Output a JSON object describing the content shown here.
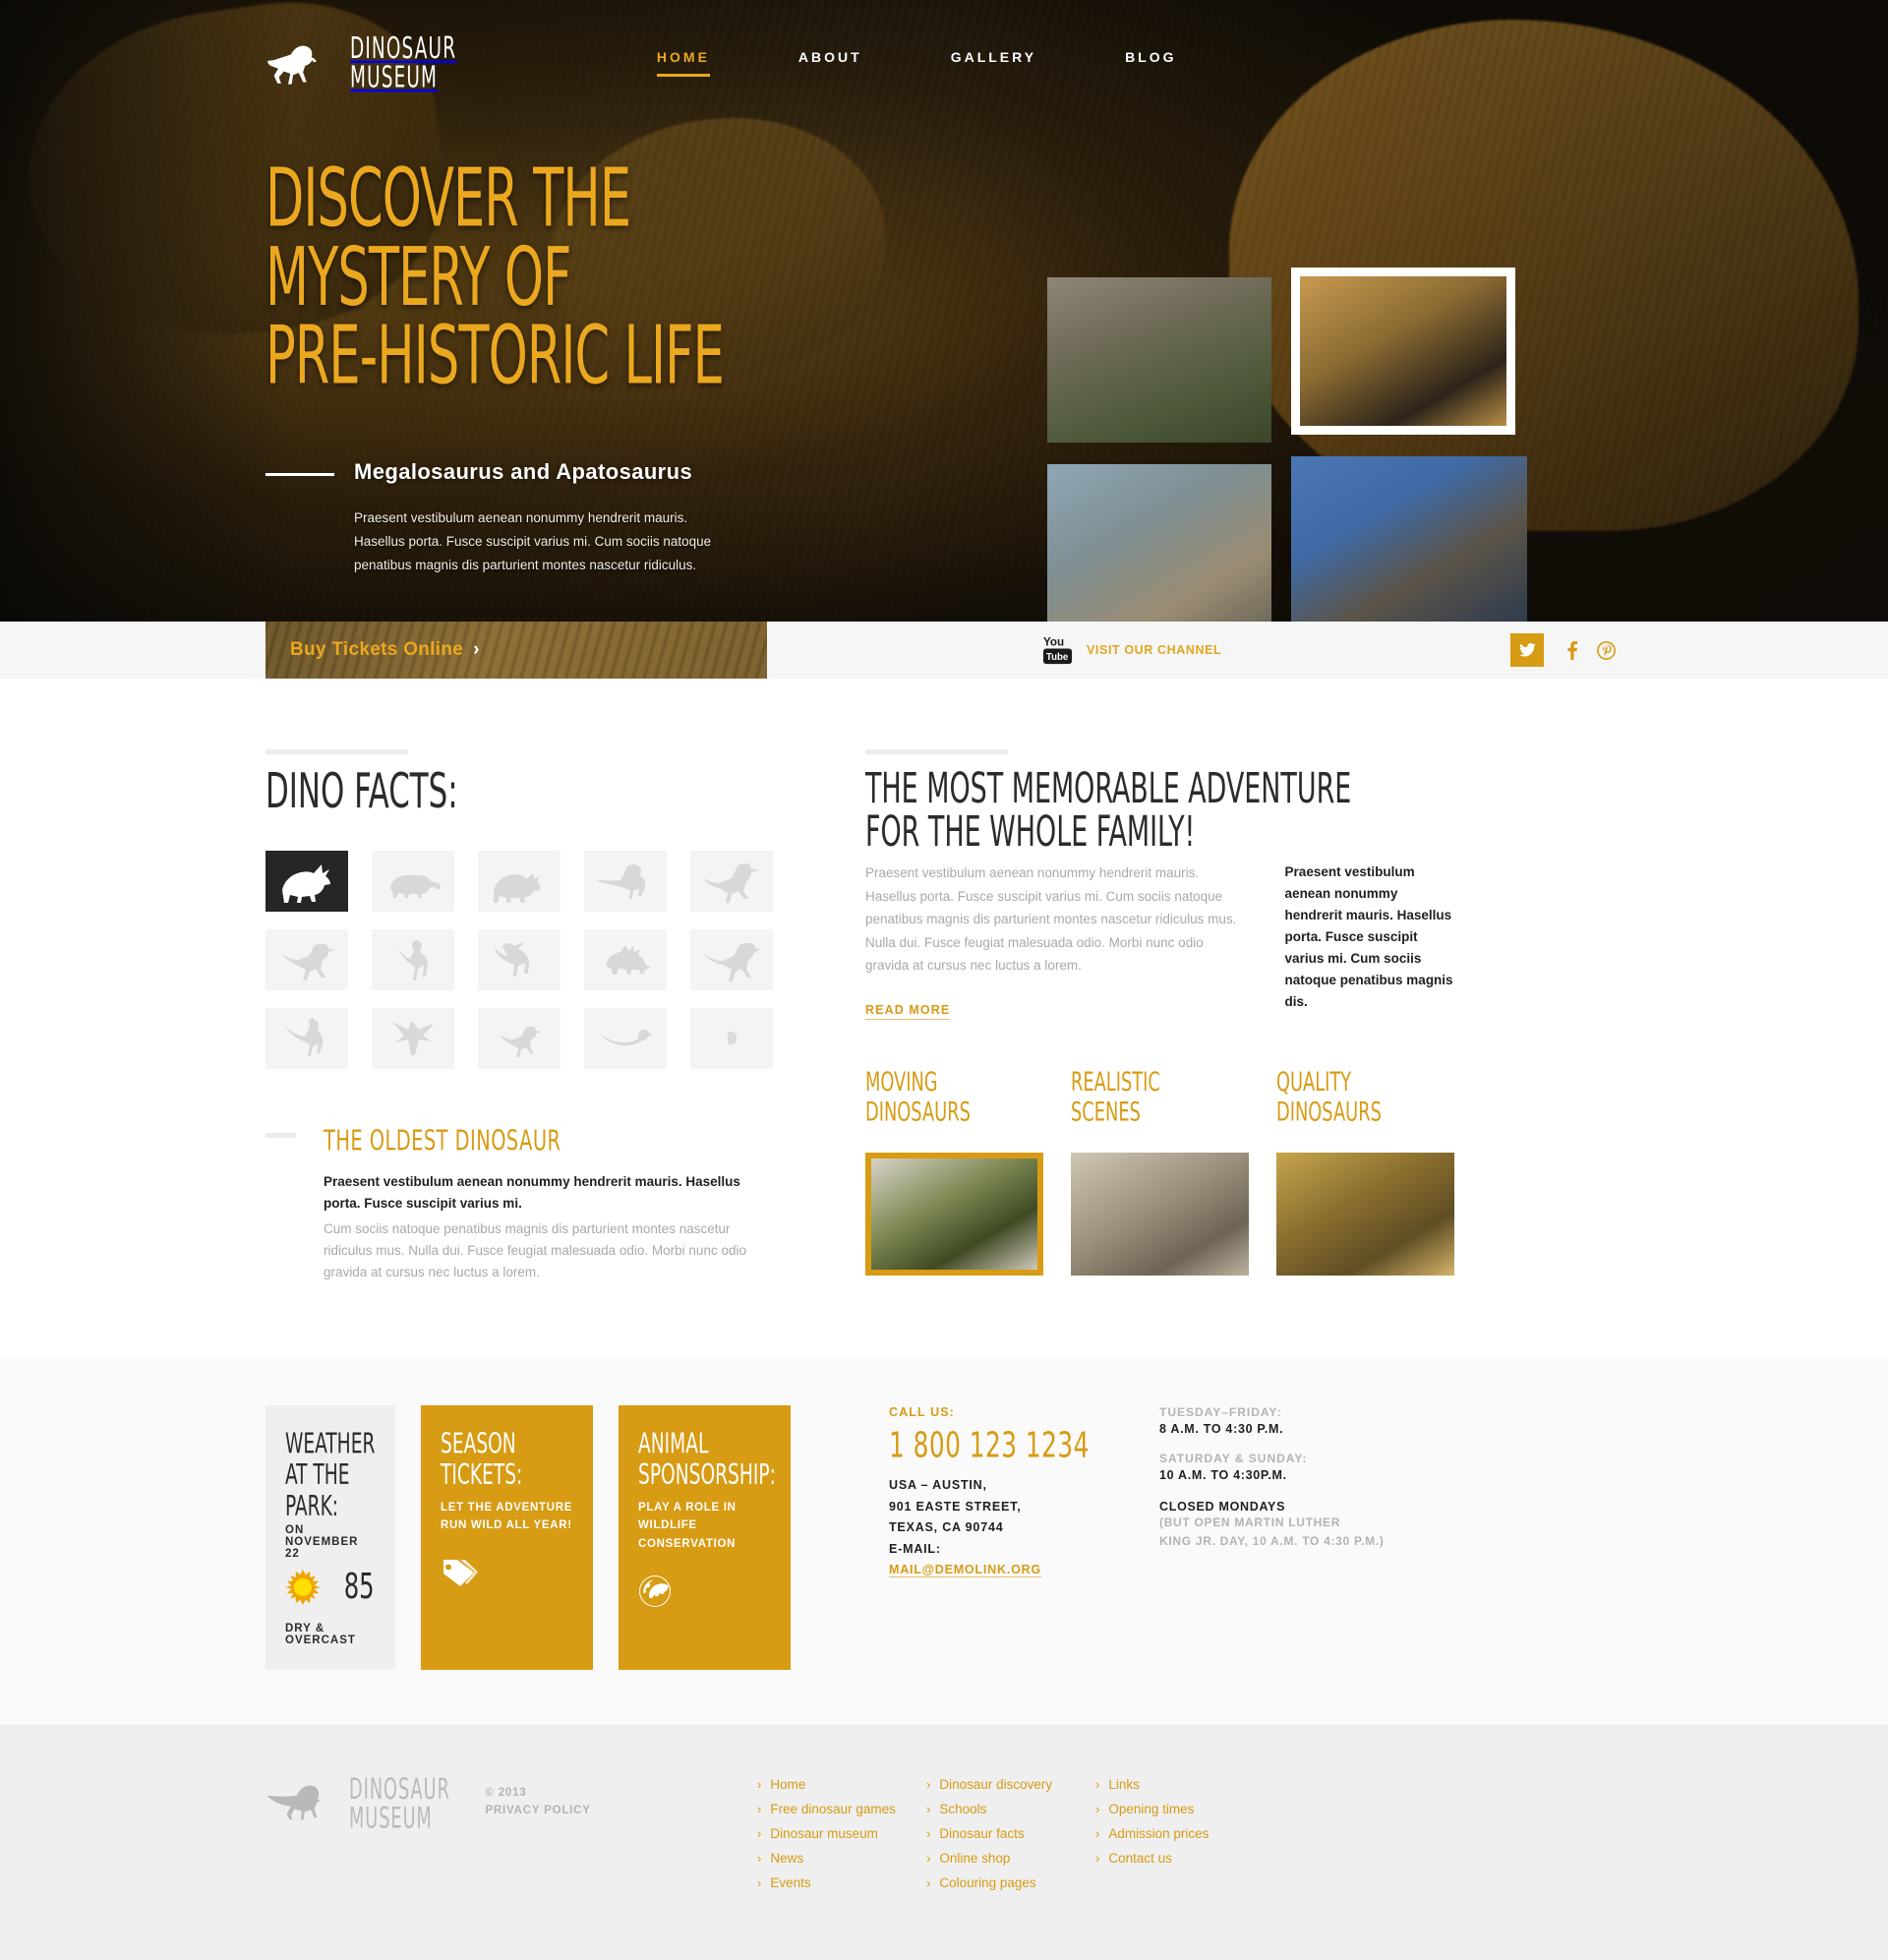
{
  "brand": {
    "line1": "Dinosaur",
    "line2": "Museum",
    "logo_icon": "dinosaur-silhouette-icon"
  },
  "nav": {
    "items": [
      {
        "label": "HOME",
        "active": true
      },
      {
        "label": "ABOUT",
        "active": false
      },
      {
        "label": "GALLERY",
        "active": false
      },
      {
        "label": "BLOG",
        "active": false
      }
    ]
  },
  "hero": {
    "title_line1": "DISCOVER THE",
    "title_line2": "MYSTERY OF",
    "title_line3": "PRE-HISTORIC LIFE",
    "subtitle": "Megalosaurus and Apatosaurus",
    "paragraph": "Praesent vestibulum aenean nonummy hendrerit mauris. Hasellus porta. Fusce suscipit varius mi. Cum sociis natoque penatibus magnis dis parturient montes nascetur ridiculus.",
    "gallery": [
      {
        "name": "thumb-allosaurus-head"
      },
      {
        "name": "thumb-museum-dinosaur-active"
      },
      {
        "name": "thumb-blue-dinosaur-head"
      },
      {
        "name": "thumb-roaring-dinosaur"
      }
    ]
  },
  "ticketbar": {
    "buy_label": "Buy Tickets Online",
    "buy_chevron": "›",
    "youtube_label": "VISIT OUR CHANNEL",
    "youtube_top": "You",
    "youtube_bottom": "Tube",
    "socials": [
      {
        "name": "twitter-icon",
        "boxed": true
      },
      {
        "name": "facebook-icon",
        "boxed": false
      },
      {
        "name": "pinterest-icon",
        "boxed": false
      }
    ]
  },
  "dinofacts": {
    "title": "DINO FACTS:",
    "icons": [
      {
        "name": "triceratops-icon",
        "active": true
      },
      {
        "name": "ankylosaurus-icon",
        "active": false
      },
      {
        "name": "triceratops-side-icon",
        "active": false
      },
      {
        "name": "brachiosaurus-icon",
        "active": false
      },
      {
        "name": "velociraptor-icon",
        "active": false
      },
      {
        "name": "raptor-running-icon",
        "active": false
      },
      {
        "name": "gallimimus-icon",
        "active": false
      },
      {
        "name": "parasaurolophus-icon",
        "active": false
      },
      {
        "name": "stegosaurus-icon",
        "active": false
      },
      {
        "name": "tyrannosaurus-icon",
        "active": false
      },
      {
        "name": "diplodocus-icon",
        "active": false
      },
      {
        "name": "pterodactyl-icon",
        "active": false
      },
      {
        "name": "compsognathus-icon",
        "active": false
      },
      {
        "name": "plesiosaur-icon",
        "active": false
      },
      {
        "name": "more-icon",
        "active": false
      }
    ],
    "oldest_heading": "THE OLDEST DINOSAUR",
    "oldest_lead": "Praesent vestibulum aenean nonummy hendrerit mauris. Hasellus porta. Fusce suscipit varius mi.",
    "oldest_muted": "Cum sociis natoque penatibus magnis dis parturient montes nascetur ridiculus mus. Nulla dui. Fusce feugiat malesuada odio. Morbi nunc odio gravida at cursus nec luctus a lorem."
  },
  "adventure": {
    "title_line1": "THE MOST MEMORABLE ADVENTURE",
    "title_line2": "FOR THE WHOLE FAMILY!",
    "body": "Praesent vestibulum aenean nonummy hendrerit mauris. Hasellus porta. Fusce suscipit varius mi. Cum sociis natoque penatibus magnis dis parturient montes nascetur ridiculus mus. Nulla dui. Fusce feugiat malesuada odio. Morbi nunc odio gravida at cursus nec luctus a lorem.",
    "aside": "Praesent vestibulum aenean nonummy hendrerit mauris. Hasellus porta. Fusce suscipit varius mi. Cum sociis natoque penatibus magnis dis.",
    "read_more": "READ MORE",
    "features": [
      {
        "title_line1": "MOVING",
        "title_line2": "DINOSAURS",
        "image_name": "moving-dinosaurs-photo"
      },
      {
        "title_line1": "REALISTIC",
        "title_line2": "SCENES",
        "image_name": "realistic-scenes-photo"
      },
      {
        "title_line1": "QUALITY",
        "title_line2": "DINOSAURS",
        "image_name": "quality-dinosaurs-photo"
      }
    ]
  },
  "info": {
    "weather": {
      "title_line1": "WEATHER",
      "title_line2": "AT THE PARK:",
      "date": "ON NOVEMBER 22",
      "temperature": "85",
      "condition": "DRY & OVERCAST",
      "icon": "sun-icon"
    },
    "season": {
      "title_line1": "SEASON",
      "title_line2": "TICKETS:",
      "text": "LET THE ADVENTURE RUN WILD ALL YEAR!",
      "icon": "tag-icon"
    },
    "sponsorship": {
      "title_line1": "ANIMAL",
      "title_line2": "SPONSORSHIP:",
      "text": "PLAY A ROLE IN WILDLIFE CONSERVATION",
      "icon": "globe-icon"
    },
    "contact": {
      "call_label": "CALL US:",
      "phone": "1 800 123 1234",
      "address_line1": "USA – AUSTIN,",
      "address_line2": "901 EASTE STREET,",
      "address_line3": "TEXAS, CA 90744",
      "email_label": "E-MAIL:",
      "email": "MAIL@DEMOLINK.ORG"
    },
    "hours": [
      {
        "label": "TUESDAY–FRIDAY:",
        "value": "8 A.M. TO 4:30 P.M."
      },
      {
        "label": "SATURDAY & SUNDAY:",
        "value": "10 A.M. TO 4:30P.M."
      }
    ],
    "closed_title": "CLOSED MONDAYS",
    "closed_note_1": "(BUT OPEN MARTIN LUTHER",
    "closed_note_2": "KING JR. DAY, 10 A.M. TO 4:30 P.M.)"
  },
  "footer": {
    "copyright": "© 2013",
    "privacy": "PRIVACY POLICY",
    "columns": [
      {
        "links": [
          "Home",
          "Free dinosaur games",
          "Dinosaur museum",
          "News",
          "Events"
        ]
      },
      {
        "links": [
          "Dinosaur discovery",
          "Schools",
          "Dinosaur facts",
          "Online shop",
          "Colouring pages"
        ]
      },
      {
        "links": [
          "Links",
          "Opening times",
          "Admission prices",
          "Contact us"
        ]
      }
    ]
  },
  "colors": {
    "accent": "#d79b14",
    "accent_bright": "#eba81f",
    "dark": "#262626",
    "muted": "#a9a9a9"
  }
}
